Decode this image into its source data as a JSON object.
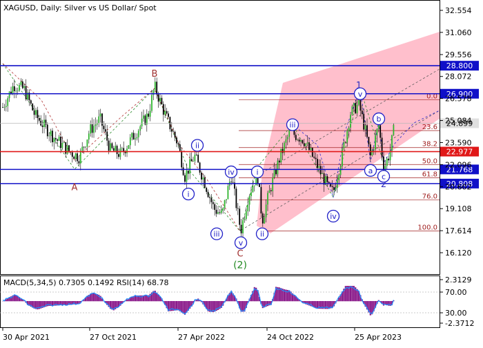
{
  "chart_data": {
    "type": "line",
    "symbol": "XAGUSD",
    "header": "XAGUSD, Daily:  Silver vs US Dollar/ Spot",
    "y_min": 15.0,
    "y_max": 33.0,
    "price_ticks": [
      "32.554",
      "31.060",
      "29.556",
      "28.072",
      "26.578",
      "25.084",
      "23.590",
      "22.096",
      "20.602",
      "19.108",
      "17.614",
      "16.120"
    ],
    "x_ticks": [
      "30 Apr 2021",
      "27 Oct 2021",
      "27 Apr 2022",
      "24 Oct 2022",
      "25 Apr 2023"
    ],
    "horizontal_levels": [
      {
        "label": "28.800",
        "value": 28.8,
        "color": "#1010c8"
      },
      {
        "label": "26.900",
        "value": 26.9,
        "color": "#1010c8"
      },
      {
        "label": "22.977",
        "value": 22.977,
        "color": "#e01818"
      },
      {
        "label": "21.768",
        "value": 21.768,
        "color": "#1010c8"
      },
      {
        "label": "20.808",
        "value": 20.808,
        "color": "#1010c8"
      }
    ],
    "current_price": {
      "label": "24.899",
      "value": 24.899
    },
    "fib_levels": [
      {
        "label": "0.0",
        "value": 26.5
      },
      {
        "label": "23.6",
        "value": 24.4
      },
      {
        "label": "38.2",
        "value": 23.25
      },
      {
        "label": "50.0",
        "value": 22.1
      },
      {
        "label": "61.8",
        "value": 21.2
      },
      {
        "label": "76.0",
        "value": 19.7
      },
      {
        "label": "100.0",
        "value": 17.6
      }
    ],
    "wave_labels": [
      {
        "text": "B",
        "style": "plain",
        "color": "#a03030",
        "x": 224,
        "price": 28.3
      },
      {
        "text": "A",
        "style": "plain",
        "color": "#a03030",
        "x": 108,
        "price": 20.6
      },
      {
        "text": "C",
        "style": "plain",
        "color": "#a03030",
        "x": 348,
        "price": 16.1
      },
      {
        "text": "(2)",
        "style": "plain",
        "color": "#208820",
        "x": 348,
        "price": 15.3
      },
      {
        "text": "1",
        "style": "plain",
        "color": "#3030c0",
        "x": 520,
        "price": 27.5
      },
      {
        "text": "2",
        "style": "plain",
        "color": "#3030c0",
        "x": 556,
        "price": 20.8
      },
      {
        "text": "i",
        "style": "circle",
        "color": "#2020c8",
        "x": 273,
        "price": 20.1
      },
      {
        "text": "ii",
        "style": "circle",
        "color": "#2020c8",
        "x": 286,
        "price": 23.4
      },
      {
        "text": "iii",
        "style": "circle",
        "color": "#2020c8",
        "x": 314,
        "price": 17.4
      },
      {
        "text": "iv",
        "style": "circle",
        "color": "#2020c8",
        "x": 335,
        "price": 21.6
      },
      {
        "text": "v",
        "style": "circle",
        "color": "#2020c8",
        "x": 349,
        "price": 16.8
      },
      {
        "text": "i",
        "style": "circle",
        "color": "#2020c8",
        "x": 373,
        "price": 21.6
      },
      {
        "text": "ii",
        "style": "circle",
        "color": "#2020c8",
        "x": 380,
        "price": 17.4
      },
      {
        "text": "iii",
        "style": "circle",
        "color": "#2020c8",
        "x": 424,
        "price": 24.8
      },
      {
        "text": "iv",
        "style": "circle",
        "color": "#2020c8",
        "x": 483,
        "price": 18.6
      },
      {
        "text": "v",
        "style": "circle",
        "color": "#2020c8",
        "x": 522,
        "price": 26.9
      },
      {
        "text": "a",
        "style": "circle",
        "color": "#2020c8",
        "x": 537,
        "price": 21.7
      },
      {
        "text": "b",
        "style": "circle",
        "color": "#2020c8",
        "x": 549,
        "price": 25.2
      },
      {
        "text": "c",
        "style": "circle",
        "color": "#2020c8",
        "x": 556,
        "price": 21.3
      }
    ],
    "indicator": {
      "header": "MACD(5,34,5) 0.7305 0.1492 RSI(14) 68.78",
      "ticks": [
        "2.3129",
        "70.00",
        "30.00",
        "-2.3712"
      ]
    }
  }
}
